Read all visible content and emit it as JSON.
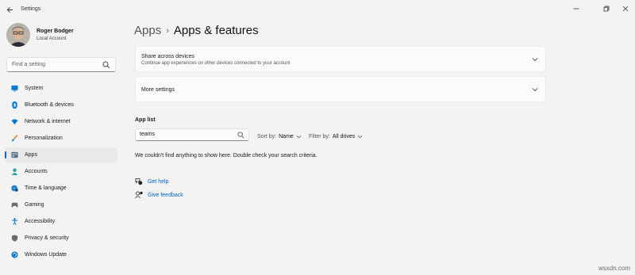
{
  "window": {
    "title": "Settings",
    "controls": [
      "minimize-icon",
      "restore-icon",
      "close-icon"
    ]
  },
  "profile": {
    "name": "Roger Bodger",
    "account": "Local Account"
  },
  "search": {
    "placeholder": "Find a setting"
  },
  "sidebar": {
    "items": [
      {
        "label": "System",
        "icon": "system-icon",
        "color": "#0078d4"
      },
      {
        "label": "Bluetooth & devices",
        "icon": "bluetooth-icon",
        "color": "#0078d4"
      },
      {
        "label": "Network & internet",
        "icon": "wifi-icon",
        "color": "#0078d4"
      },
      {
        "label": "Personalization",
        "icon": "brush-icon",
        "color": "#e8772e"
      },
      {
        "label": "Apps",
        "icon": "apps-icon",
        "color": "#5a6b7c",
        "active": true
      },
      {
        "label": "Accounts",
        "icon": "person-icon",
        "color": "#2ea0a6"
      },
      {
        "label": "Time & language",
        "icon": "globe-clock-icon",
        "color": "#0078d4"
      },
      {
        "label": "Gaming",
        "icon": "gamepad-icon",
        "color": "#6b6b6b"
      },
      {
        "label": "Accessibility",
        "icon": "accessibility-icon",
        "color": "#0078d4"
      },
      {
        "label": "Privacy & security",
        "icon": "shield-icon",
        "color": "#6b6b6b"
      },
      {
        "label": "Windows Update",
        "icon": "update-icon",
        "color": "#0078d4"
      }
    ]
  },
  "breadcrumb": {
    "parent": "Apps",
    "separator": "›",
    "current": "Apps & features"
  },
  "cards": {
    "share": {
      "title": "Share across devices",
      "subtitle": "Continue app experiences on other devices connected to your account"
    },
    "more": {
      "title": "More settings"
    }
  },
  "app_list": {
    "label": "App list",
    "search_value": "teams",
    "sort_label": "Sort by:",
    "sort_value": "Name",
    "filter_label": "Filter by:",
    "filter_value": "All drives",
    "empty_message": "We couldn't find anything to show here. Double check your search criteria."
  },
  "links": {
    "help": "Get help",
    "feedback": "Give feedback"
  },
  "watermark": "wsxdn.com",
  "colors": {
    "accent": "#0067c0",
    "background": "#f3f3f3",
    "card": "#fbfbfb"
  }
}
